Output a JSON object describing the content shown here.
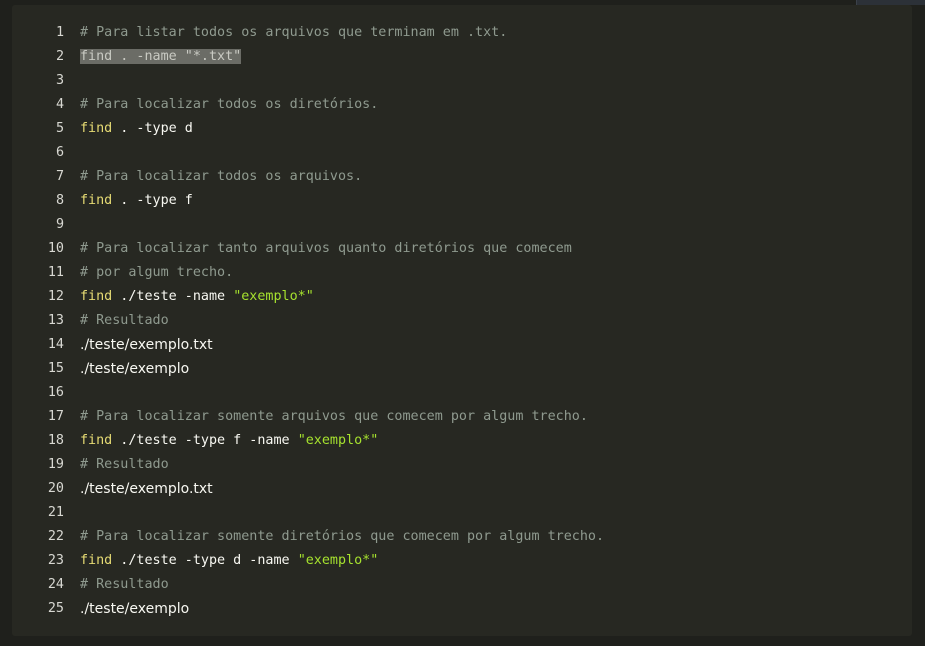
{
  "editor": {
    "lines": [
      {
        "num": "1",
        "comment": "# Para listar todos os arquivos que terminam em .txt."
      },
      {
        "num": "2",
        "selected": "find . -name \"*.txt\""
      },
      {
        "num": "3"
      },
      {
        "num": "4",
        "comment": "# Para localizar todos os diretórios."
      },
      {
        "num": "5",
        "kw": "find",
        "plain": " . -type d"
      },
      {
        "num": "6"
      },
      {
        "num": "7",
        "comment": "# Para localizar todos os arquivos."
      },
      {
        "num": "8",
        "kw": "find",
        "plain": " . -type f"
      },
      {
        "num": "9"
      },
      {
        "num": "10",
        "comment": "# Para localizar tanto arquivos quanto diretórios que comecem"
      },
      {
        "num": "11",
        "comment": "# por algum trecho."
      },
      {
        "num": "12",
        "kw": "find",
        "plain": " ./teste -name ",
        "str": "\"exemplo*\""
      },
      {
        "num": "13",
        "comment": "# Resultado"
      },
      {
        "num": "14",
        "output": "./teste/exemplo.txt"
      },
      {
        "num": "15",
        "output": "./teste/exemplo"
      },
      {
        "num": "16"
      },
      {
        "num": "17",
        "comment": "# Para localizar somente arquivos que comecem por algum trecho."
      },
      {
        "num": "18",
        "kw": "find",
        "plain": " ./teste -type f -name ",
        "str": "\"exemplo*\""
      },
      {
        "num": "19",
        "comment": "# Resultado"
      },
      {
        "num": "20",
        "output": "./teste/exemplo.txt"
      },
      {
        "num": "21"
      },
      {
        "num": "22",
        "comment": "# Para localizar somente diretórios que comecem por algum trecho."
      },
      {
        "num": "23",
        "kw": "find",
        "plain": " ./teste -type d -name ",
        "str": "\"exemplo*\""
      },
      {
        "num": "24",
        "comment": "# Resultado"
      },
      {
        "num": "25",
        "output": "./teste/exemplo"
      }
    ]
  },
  "colors": {
    "background": "#272822",
    "comment": "#8f9a8f",
    "keyword": "#e6db74",
    "string": "#a6e22e",
    "text": "#f8f8f2",
    "selection": "#6b6c66"
  }
}
